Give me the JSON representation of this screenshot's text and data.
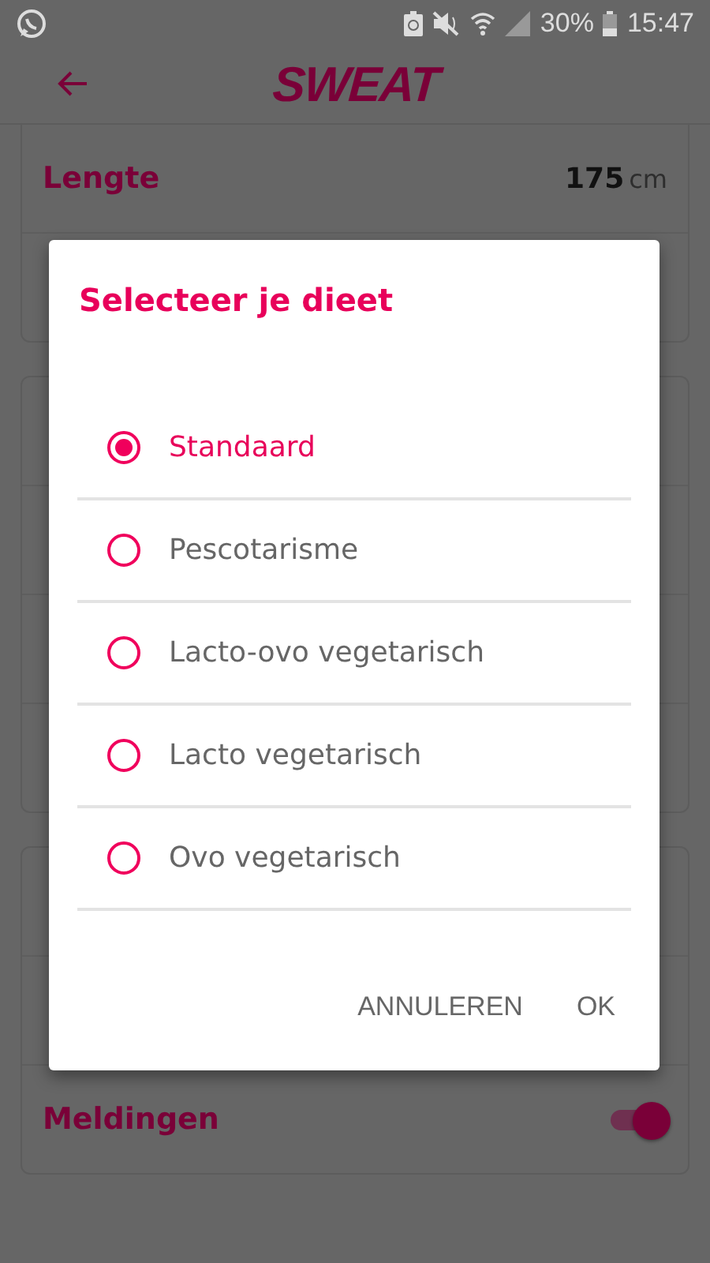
{
  "status_bar": {
    "battery_text": "30%",
    "time": "15:47"
  },
  "header": {
    "logo": "SWEAT"
  },
  "cards": [
    {
      "rows": [
        {
          "kind": "value",
          "label": "Lengte",
          "value": "175",
          "unit": "cm"
        },
        {
          "kind": "covered"
        }
      ]
    },
    {
      "rows": [
        {
          "kind": "covered"
        },
        {
          "kind": "covered"
        },
        {
          "kind": "covered"
        },
        {
          "kind": "covered"
        }
      ]
    },
    {
      "rows": [
        {
          "kind": "covered"
        },
        {
          "kind": "covered"
        },
        {
          "kind": "toggle",
          "label": "Meldingen",
          "on": true
        }
      ]
    }
  ],
  "dialog": {
    "title": "Selecteer je dieet",
    "options": [
      {
        "label": "Standaard",
        "selected": true
      },
      {
        "label": "Pescotarisme",
        "selected": false
      },
      {
        "label": "Lacto-ovo vegetarisch",
        "selected": false
      },
      {
        "label": "Lacto vegetarisch",
        "selected": false
      },
      {
        "label": "Ovo vegetarisch",
        "selected": false
      }
    ],
    "buttons": [
      "ANNULEREN",
      "OK"
    ]
  }
}
